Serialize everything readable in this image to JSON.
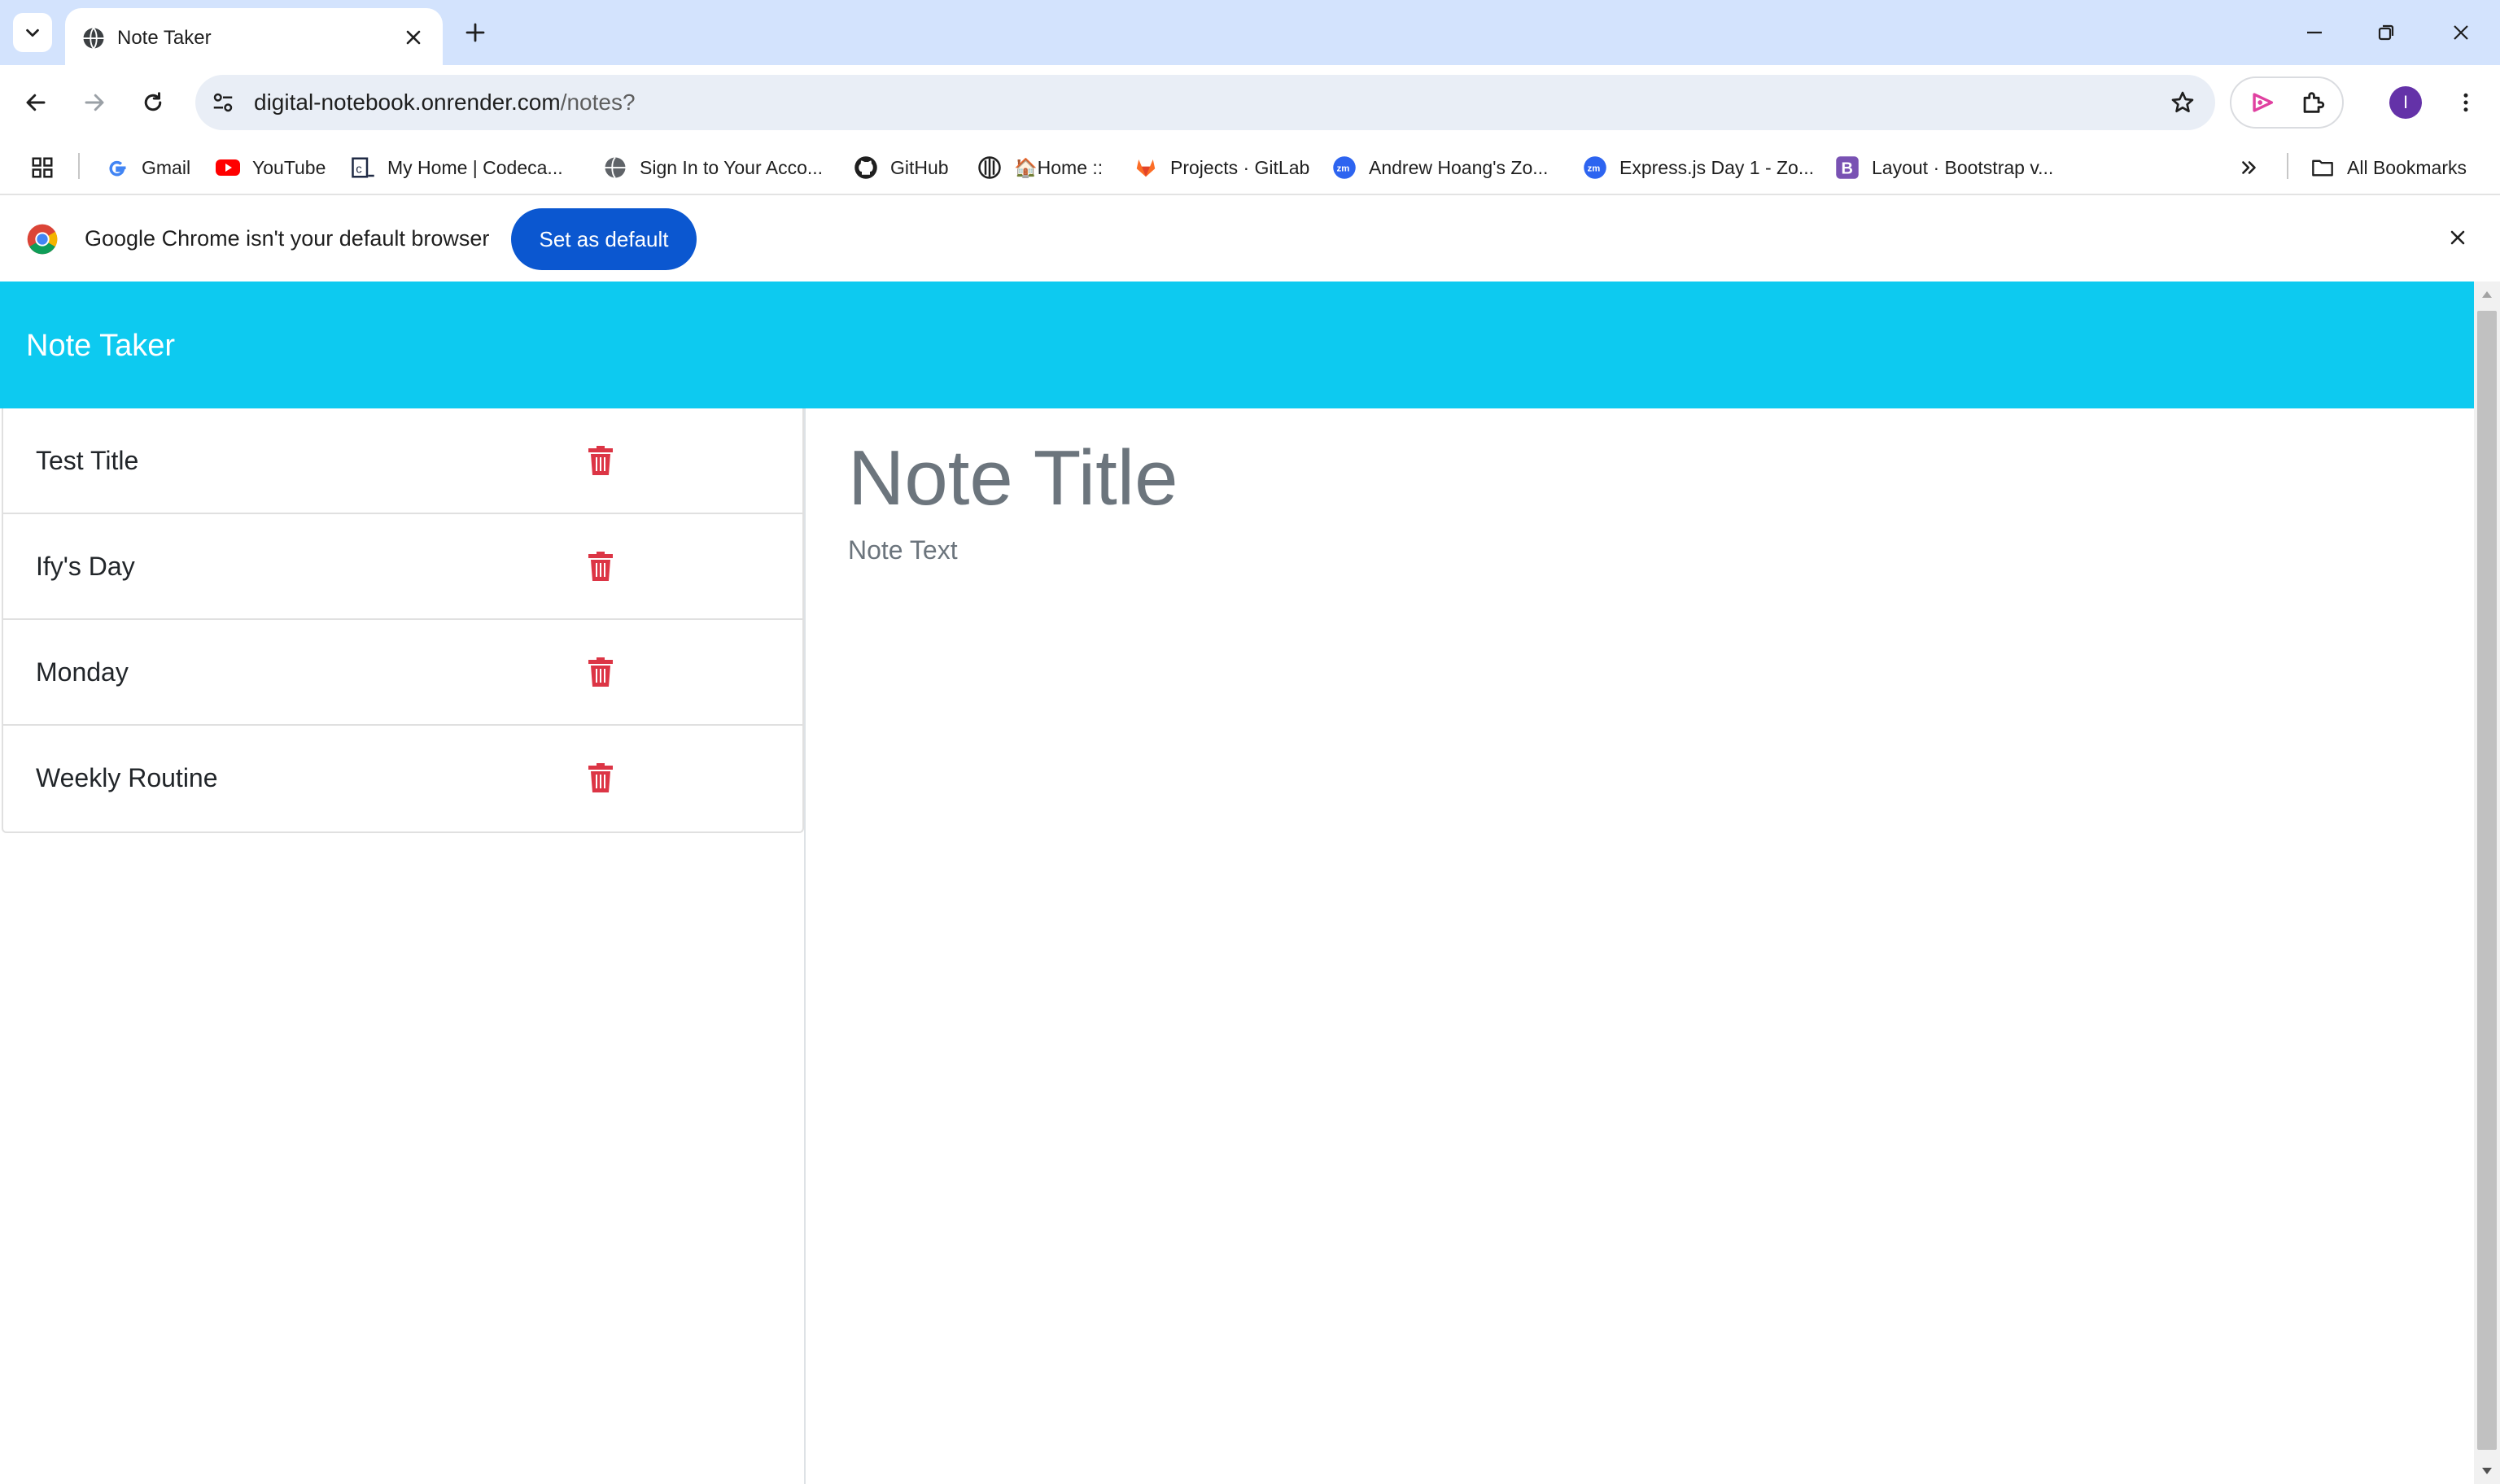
{
  "browser": {
    "tab": {
      "title": "Note Taker"
    },
    "url": {
      "host": "digital-notebook.onrender.com",
      "path": "/notes?"
    },
    "profile_initial": "I",
    "bookmarks": [
      {
        "label": "Gmail",
        "icon": "google-g-icon"
      },
      {
        "label": "YouTube",
        "icon": "youtube-icon"
      },
      {
        "label": "My Home | Codeca...",
        "icon": "codecademy-icon"
      },
      {
        "label": "Sign In to Your Acco...",
        "icon": "globe-icon"
      },
      {
        "label": "GitHub",
        "icon": "github-icon"
      },
      {
        "label": "🏠Home ::",
        "icon": "site-icon"
      },
      {
        "label": "Projects · GitLab",
        "icon": "gitlab-icon"
      },
      {
        "label": "Andrew Hoang's Zo...",
        "icon": "zoom-icon"
      },
      {
        "label": "Express.js Day 1 - Zo...",
        "icon": "zoom-icon"
      },
      {
        "label": "Layout · Bootstrap v...",
        "icon": "bootstrap-icon"
      }
    ],
    "all_bookmarks_label": "All Bookmarks",
    "infobar": {
      "message": "Google Chrome isn't your default browser",
      "button_label": "Set as default"
    }
  },
  "app": {
    "brand": "Note Taker",
    "notes": [
      {
        "title": "Test Title"
      },
      {
        "title": "Ify's Day"
      },
      {
        "title": "Monday"
      },
      {
        "title": "Weekly Routine"
      }
    ],
    "editor": {
      "title_placeholder": "Note Title",
      "text_placeholder": "Note Text"
    }
  },
  "colors": {
    "header": "#0dcaf0",
    "trash": "#dc3545",
    "tabstrip": "#d3e3fd",
    "primary_button": "#0b57d0"
  }
}
